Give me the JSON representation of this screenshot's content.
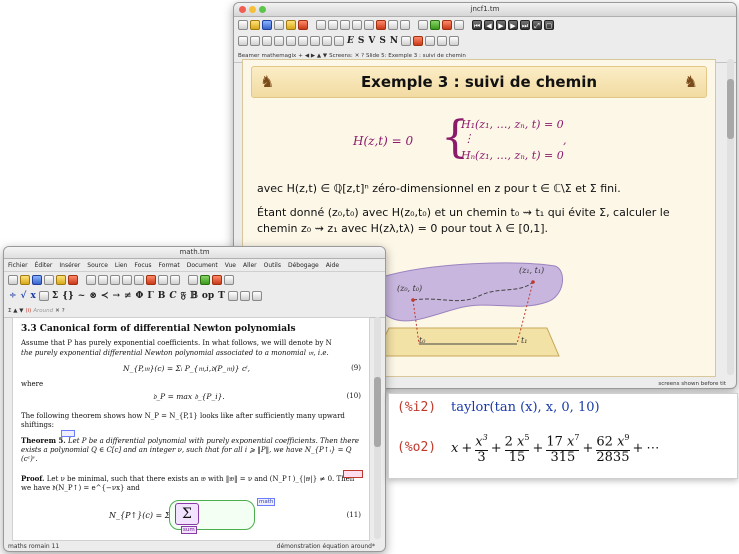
{
  "slides_window": {
    "title": "jncf1.tm",
    "focus_bar": {
      "style": "Beamer",
      "packages": "mathemagix",
      "screens": "Screens:",
      "location": "Slide 5: Exemple 3 : suivi de chemin"
    },
    "slide": {
      "heading": "Exemple 3 : suivi de chemin",
      "system_lhs": "H(z,t) = 0",
      "system_rows": [
        "H₁(z₁, …, zₙ, t) = 0",
        "⋮",
        "Hₙ(z₁, …, zₙ, t) = 0"
      ],
      "system_trailer": ",",
      "line1": "avec H(z,t) ∈ ℚ[z,t]ⁿ zéro-dimensionnel en z pour t ∈ ℂ\\Σ et Σ fini.",
      "line2": "Étant donné (z₀,t₀) avec H(z₀,t₀) et un chemin t₀ ⇝ t₁ qui évite Σ, calculer le",
      "line3": "chemin z₀ ⇝ z₁ avec H(zλ,tλ) = 0 pour tout λ ∈ [0,1].",
      "diagram": {
        "start_label": "(z₀, t₀)",
        "end_label": "(z₁, t₁)",
        "t0": "t₀",
        "t1": "t₁"
      }
    },
    "status_right": "screens shown before tit"
  },
  "math_window": {
    "title": "math.tm",
    "menu": [
      "Fichier",
      "Éditer",
      "Insérer",
      "Source",
      "Lien",
      "Focus",
      "Format",
      "Document",
      "Vue",
      "Aller",
      "Outils",
      "Débogage",
      "Aide"
    ],
    "focus_bar": {
      "tag": "(i)",
      "mode": "Around",
      "close": "✕",
      "help": "?"
    },
    "section": "3.3  Canonical form of differential Newton polynomials",
    "p1a": "Assume that P has purely exponential coefficients. In what follows, we will denote by N",
    "p1b": "the purely exponential differential Newton polynomial associated to a monomial 𝔪, i.e.",
    "eq9": "N_{P,𝔪}(c) = Σᵢ P_{𝔪,i,𝔡(P_𝔪)} cⁱ,",
    "eq9_no": "(9)",
    "where": "where",
    "eq10": "𝔡_P = max 𝔡_{P_i}.",
    "eq10_no": "(10)",
    "p2": "The following theorem shows how N_P = N_{P,1} looks like after sufficiently many upward shiftings:",
    "theorem_head": "Theorem 5.",
    "theorem_body": "Let P be a differential polynomial with purely exponential coefficients. Then there exists a polynomial Q ∈ C[c] and an integer ν, such that for all i ⩾ ‖P‖, we have N_{P↑ᵢ} = Q (cᶜ)ᵛ.",
    "proof_head": "Proof.",
    "proof_body": "Let ν be minimal, such that there exists an 𝔴 with ‖𝔴‖ = ν and (N_P↑)_{|𝔴|} ≠ 0. Then we have 𝔡(N_P↑) = e^{−νx} and",
    "eq11_lhs": "N_{P↑}(c) = Σ",
    "eq11_no": "(11)",
    "tag_math": "math",
    "tag_sum": "sum",
    "status_left": "maths romain 11",
    "status_right": "démonstration équation around*"
  },
  "session_panel": {
    "input_prompt": "(%i2)",
    "input": "taylor(tan (x), x, 0, 10)",
    "output_prompt": "(%o2)"
  },
  "colors": {
    "prompt": "#c0392b",
    "input": "#1a3aa8",
    "slide_heading_bg": "#f7e6b8"
  }
}
